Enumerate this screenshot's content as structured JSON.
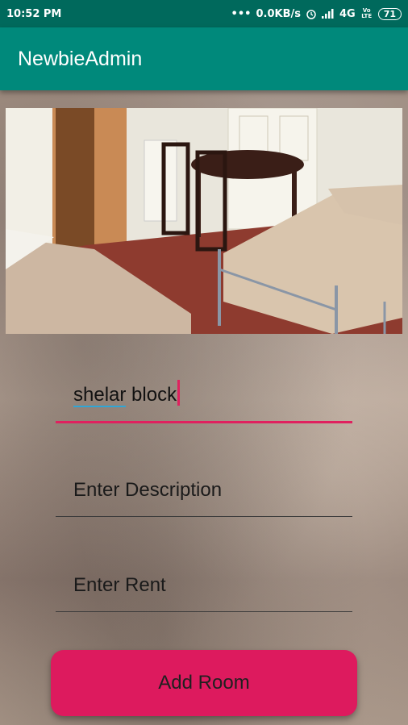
{
  "status_bar": {
    "time": "10:52 PM",
    "dots": "•••",
    "speed": "0.0KB/s",
    "network": "4G",
    "volte": "Vo LTE",
    "battery": "71"
  },
  "app_bar": {
    "title": "NewbieAdmin"
  },
  "form": {
    "name_value_word1": "shelar",
    "name_value_word2": " block",
    "description_placeholder": "Enter Description",
    "rent_placeholder": "Enter Rent",
    "add_button_label": "Add Room"
  },
  "colors": {
    "status_bar": "#00695c",
    "app_bar": "#00897b",
    "accent": "#dd1a5e"
  }
}
